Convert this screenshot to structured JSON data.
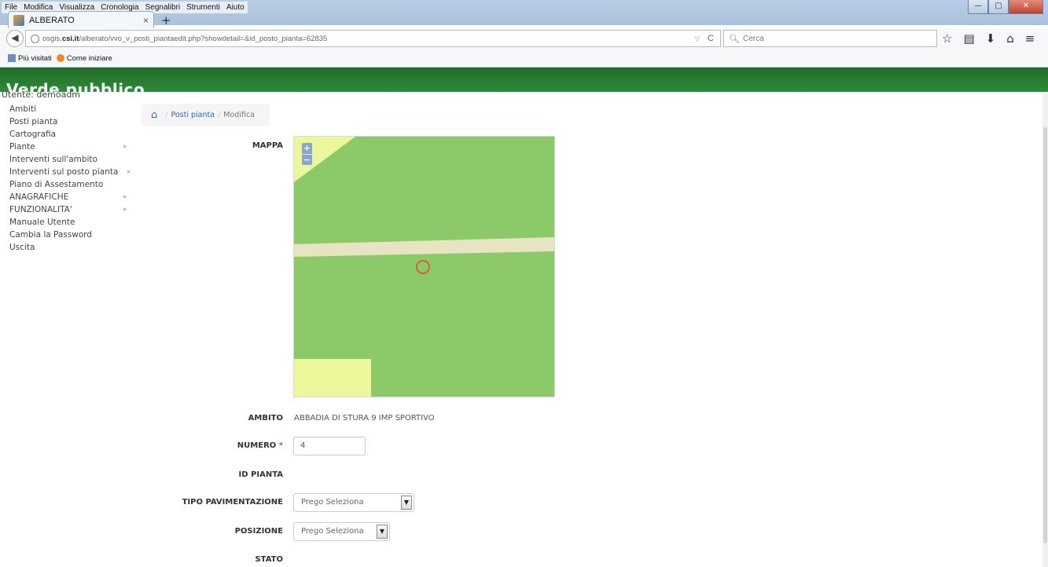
{
  "browser": {
    "menu": [
      "File",
      "Modifica",
      "Visualizza",
      "Cronologia",
      "Segnalibri",
      "Strumenti",
      "Aiuto"
    ],
    "tab_title": "ALBERATO",
    "url_host": "osgis.csi.it",
    "url_path": "/alberato/vvo_v_posti_piantaedit.php?showdetail=&id_posto_pianta=62835",
    "url_prefix": "osgis.",
    "url_bold": "csi.it",
    "url_rest": "/alberato/vvo_v_posti_piantaedit.php?showdetail=&id_posto_pianta=62835",
    "search_placeholder": "Cerca",
    "bookmarks": [
      "Più visitati",
      "Come iniziare"
    ]
  },
  "header": {
    "brand": "Verde pubblico"
  },
  "user_line": "Utente: demoadm",
  "sidebar": {
    "items": [
      {
        "label": "Ambiti",
        "submenu": false
      },
      {
        "label": "Posti pianta",
        "submenu": false
      },
      {
        "label": "Cartografia",
        "submenu": false
      },
      {
        "label": "Piante",
        "submenu": true
      },
      {
        "label": "Interventi sull'ambito",
        "submenu": false
      },
      {
        "label": "Interventi sul posto pianta",
        "submenu": true
      },
      {
        "label": "Piano di Assestamento",
        "submenu": false
      },
      {
        "label": "ANAGRAFICHE",
        "submenu": true
      },
      {
        "label": "FUNZIONALITA'",
        "submenu": true
      },
      {
        "label": "Manuale Utente",
        "submenu": false
      },
      {
        "label": "Cambia la Password",
        "submenu": false
      },
      {
        "label": "Uscita",
        "submenu": false
      }
    ]
  },
  "breadcrumb": {
    "link": "Posti pianta",
    "current": "Modifica",
    "separator": "/"
  },
  "form": {
    "mappa_label": "MAPPA",
    "ambito_label": "AMBITO",
    "ambito_value": "ABBADIA DI STURA 9 IMP SPORTIVO",
    "numero_label": "NUMERO",
    "numero_required": "*",
    "numero_value": "4",
    "id_pianta_label": "ID PIANTA",
    "tipo_pav_label": "TIPO PAVIMENTAZIONE",
    "tipo_pav_value": "Prego Seleziona",
    "posizione_label": "POSIZIONE",
    "posizione_value": "Prego Seleziona",
    "stato_label": "STATO"
  },
  "map": {
    "zoom_in": "+",
    "zoom_out": "−",
    "colors": {
      "grass": "#8cca69",
      "road": "#e6e4c2",
      "light": "#ecf79b",
      "marker": "#d4622b"
    }
  }
}
